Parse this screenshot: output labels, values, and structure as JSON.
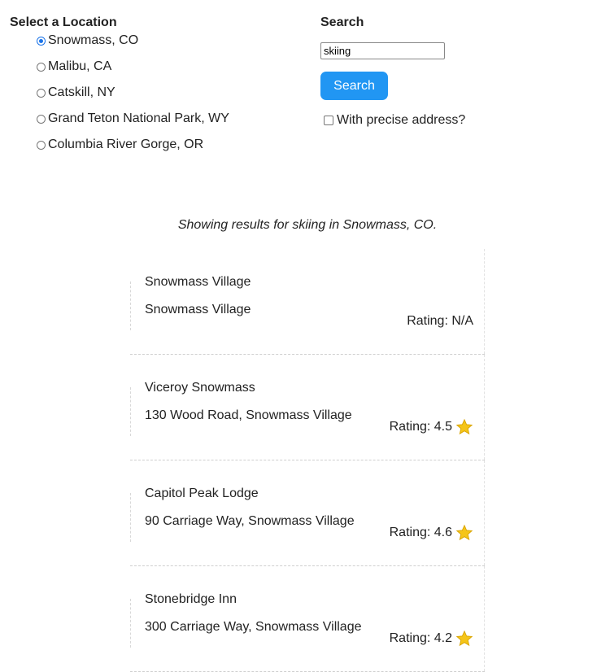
{
  "location": {
    "title": "Select a Location",
    "options": [
      {
        "label": "Snowmass, CO",
        "selected": true
      },
      {
        "label": "Malibu, CA",
        "selected": false
      },
      {
        "label": "Catskill, NY",
        "selected": false
      },
      {
        "label": "Grand Teton National Park, WY",
        "selected": false
      },
      {
        "label": "Columbia River Gorge, OR",
        "selected": false
      }
    ]
  },
  "search": {
    "title": "Search",
    "value": "skiing",
    "button_label": "Search",
    "precise_label": "With precise address?",
    "precise_checked": false
  },
  "results_caption": "Showing results for skiing in Snowmass, CO.",
  "results": [
    {
      "name": "Snowmass Village",
      "address": "Snowmass Village",
      "rating": "Rating: N/A",
      "star": false
    },
    {
      "name": "Viceroy Snowmass",
      "address": "130 Wood Road, Snowmass Village",
      "rating": "Rating: 4.5",
      "star": true
    },
    {
      "name": "Capitol Peak Lodge",
      "address": "90 Carriage Way, Snowmass Village",
      "rating": "Rating: 4.6",
      "star": true
    },
    {
      "name": "Stonebridge Inn",
      "address": "300 Carriage Way, Snowmass Village",
      "rating": "Rating: 4.2",
      "star": true
    }
  ],
  "colors": {
    "accent": "#2196f3",
    "star": "#f5c518"
  },
  "icons": {
    "star": "star-icon"
  }
}
